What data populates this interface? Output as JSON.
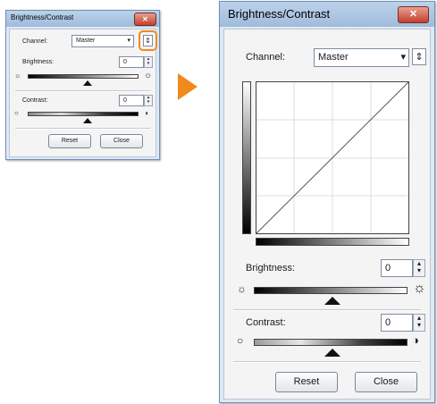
{
  "small_dialog": {
    "title": "Brightness/Contrast",
    "close_glyph": "✕",
    "channel_label": "Channel:",
    "channel_value": "Master",
    "brightness_label": "Brightness:",
    "brightness_value": "0",
    "contrast_label": "Contrast:",
    "contrast_value": "0",
    "reset_label": "Reset",
    "close_label": "Close",
    "highlight_color": "#f08a1c"
  },
  "arrow": {
    "color": "#f08a1c"
  },
  "large_dialog": {
    "title": "Brightness/Contrast",
    "close_glyph": "✕",
    "channel_label": "Channel:",
    "channel_value": "Master",
    "brightness_label": "Brightness:",
    "brightness_value": "0",
    "contrast_label": "Contrast:",
    "contrast_value": "0",
    "reset_label": "Reset",
    "close_label": "Close"
  },
  "icons": {
    "dropdown": "▾",
    "toggle": "⇕",
    "spin_up": "▴",
    "spin_down": "▾",
    "sun_dim": "☼",
    "sun_bright": "☼",
    "contrast_low": "○",
    "contrast_high": "◑"
  }
}
